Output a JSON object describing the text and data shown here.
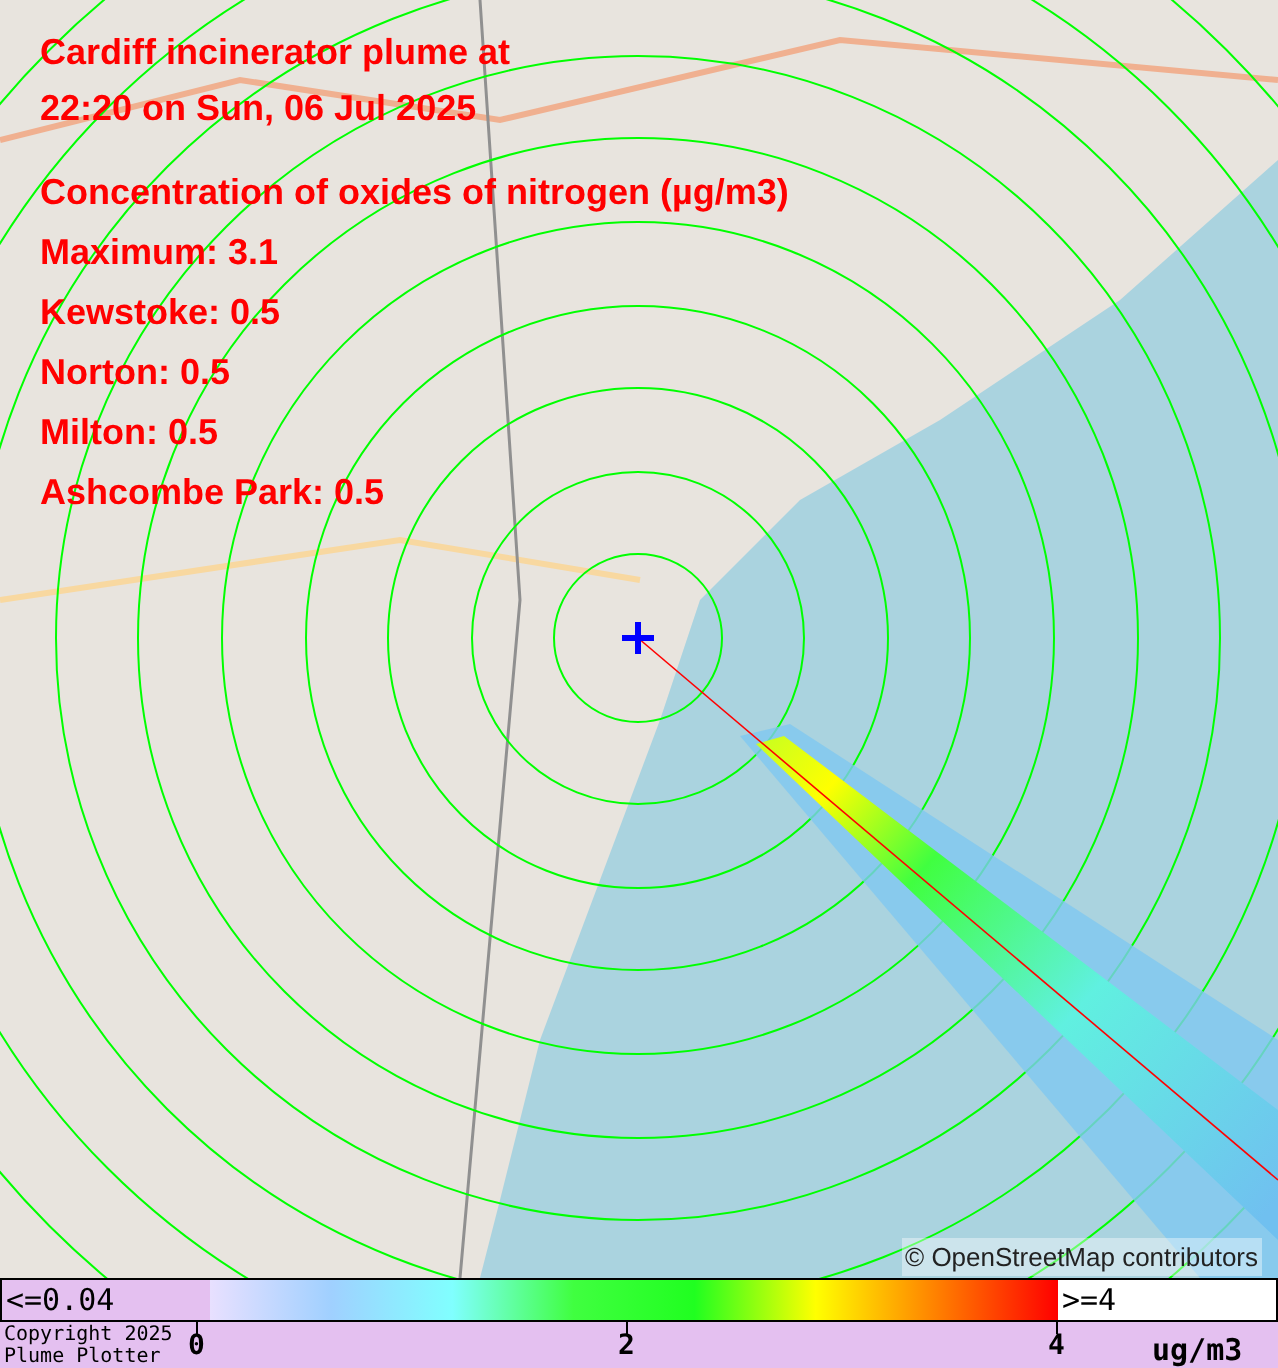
{
  "map": {
    "title_lines": [
      "Cardiff incinerator plume at",
      "22:20 on Sun, 06 Jul 2025"
    ],
    "subtitle": "Concentration of oxides of nitrogen (µg/m3)",
    "readings": [
      "Maximum: 3.1",
      "Kewstoke: 0.5",
      "Norton: 0.5",
      "Milton: 0.5",
      "Ashcombe Park: 0.5"
    ],
    "attribution": "© OpenStreetMap contributors"
  },
  "legend": {
    "below_label": "<=0.04",
    "above_label": ">=4",
    "ticks": [
      "0",
      "2",
      "4"
    ],
    "unit": "ug/m3"
  },
  "footer": {
    "copyright_lines": [
      "Copyright 2025",
      "Plume Plotter"
    ]
  }
}
